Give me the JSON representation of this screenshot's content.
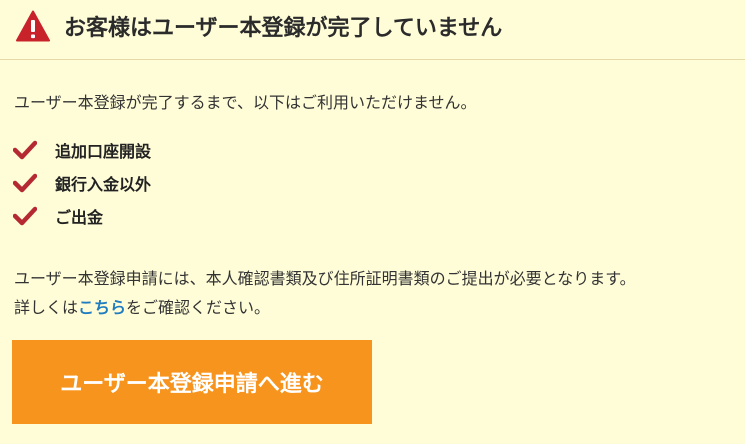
{
  "notice": {
    "title": "お客様はユーザー本登録が完了していません",
    "icon": "warning-icon",
    "intro": "ユーザー本登録が完了するまで、以下はご利用いただけません。",
    "restrictions": [
      {
        "label": "追加口座開設",
        "icon": "check-icon"
      },
      {
        "label": "銀行入金以外",
        "icon": "check-icon"
      },
      {
        "label": "ご出金",
        "icon": "check-icon"
      }
    ],
    "info_line1": "ユーザー本登録申請には、本人確認書類及び住所証明書類のご提出が必要となります。",
    "info_line2_prefix": "詳しくは",
    "info_link": "こちら",
    "info_line2_suffix": "をご確認ください。",
    "cta_label": "ユーザー本登録申請へ進む"
  },
  "colors": {
    "background": "#fffdd8",
    "warning": "#c8222b",
    "check": "#b52a32",
    "link": "#1e7cc0",
    "cta": "#f7941d"
  }
}
